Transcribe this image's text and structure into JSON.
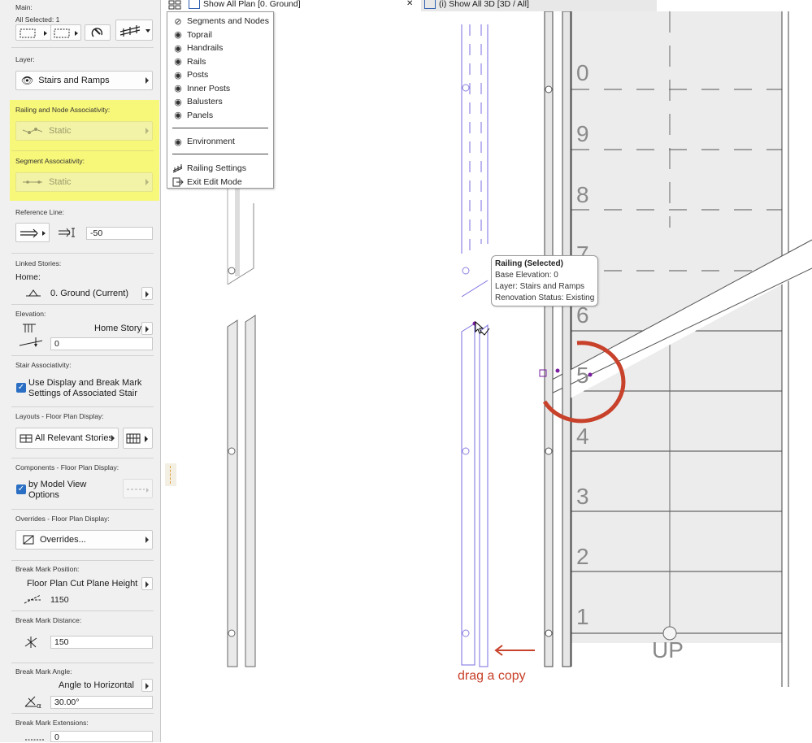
{
  "tabs": {
    "plan": "Show All Plan [0. Ground]",
    "close": "✕",
    "view3d": "(i) Show All 3D [3D / All]"
  },
  "panel": {
    "main_label": "Main:",
    "all_selected": "All Selected: 1",
    "layer_label": "Layer:",
    "layer_value": "Stairs and Ramps",
    "railing_assoc_label": "Railing and Node Associativity:",
    "railing_assoc_value": "Static",
    "segment_assoc_label": "Segment Associativity:",
    "segment_assoc_value": "Static",
    "reference_label": "Reference Line:",
    "reference_offset": "-50",
    "linked_label": "Linked Stories:",
    "home_label": "Home:",
    "home_value": "0. Ground (Current)",
    "elevation_label": "Elevation:",
    "elevation_ref": "Home Story",
    "elevation_value": "0",
    "stair_assoc_label": "Stair Associativity:",
    "stair_assoc_text1": "Use Display and Break Mark",
    "stair_assoc_text2": "Settings of Associated Stair",
    "layouts_label": "Layouts - Floor Plan Display:",
    "layouts_value": "All Relevant Stories",
    "components_label": "Components - Floor Plan Display:",
    "components_text1": "by Model View",
    "components_text2": "Options",
    "overrides_label": "Overrides - Floor Plan Display:",
    "overrides_value": "Overrides...",
    "break_pos_label": "Break Mark Position:",
    "break_pos_ref": "Floor Plan Cut Plane Height",
    "break_pos_value": "1150",
    "break_dist_label": "Break Mark Distance:",
    "break_dist_value": "150",
    "break_angle_label": "Break Mark Angle:",
    "break_angle_ref": "Angle to Horizontal",
    "break_angle_value": "30.00°",
    "break_ext_label": "Break Mark Extensions:",
    "break_ext_value": "0"
  },
  "menu": {
    "items": [
      {
        "icon": "eye-slashed-icon",
        "glyph": "⊘",
        "label": "Segments and Nodes"
      },
      {
        "icon": "eye-icon",
        "glyph": "◉",
        "label": "Toprail"
      },
      {
        "icon": "eye-icon",
        "glyph": "◉",
        "label": "Handrails"
      },
      {
        "icon": "eye-icon",
        "glyph": "◉",
        "label": "Rails"
      },
      {
        "icon": "eye-icon",
        "glyph": "◉",
        "label": "Posts"
      },
      {
        "icon": "eye-icon",
        "glyph": "◉",
        "label": "Inner Posts"
      },
      {
        "icon": "eye-icon",
        "glyph": "◉",
        "label": "Balusters"
      },
      {
        "icon": "eye-icon",
        "glyph": "◉",
        "label": "Panels"
      }
    ],
    "environment": "Environment",
    "railing_settings": "Railing Settings",
    "exit_edit": "Exit Edit Mode"
  },
  "tooltip": {
    "title": "Railing (Selected)",
    "base_elevation": "Base Elevation: 0",
    "layer": "Layer: Stairs and Ramps",
    "renovation": "Renovation Status: Existing"
  },
  "drawing": {
    "step_numbers": [
      "0",
      "9",
      "8",
      "7",
      "6",
      "5",
      "4",
      "3",
      "2",
      "1"
    ],
    "up_label": "UP",
    "annotation": "drag a copy",
    "annotation_color": "#c8412a",
    "highlight_color": "#f7f77a",
    "selection_color": "#7a6ee0"
  }
}
